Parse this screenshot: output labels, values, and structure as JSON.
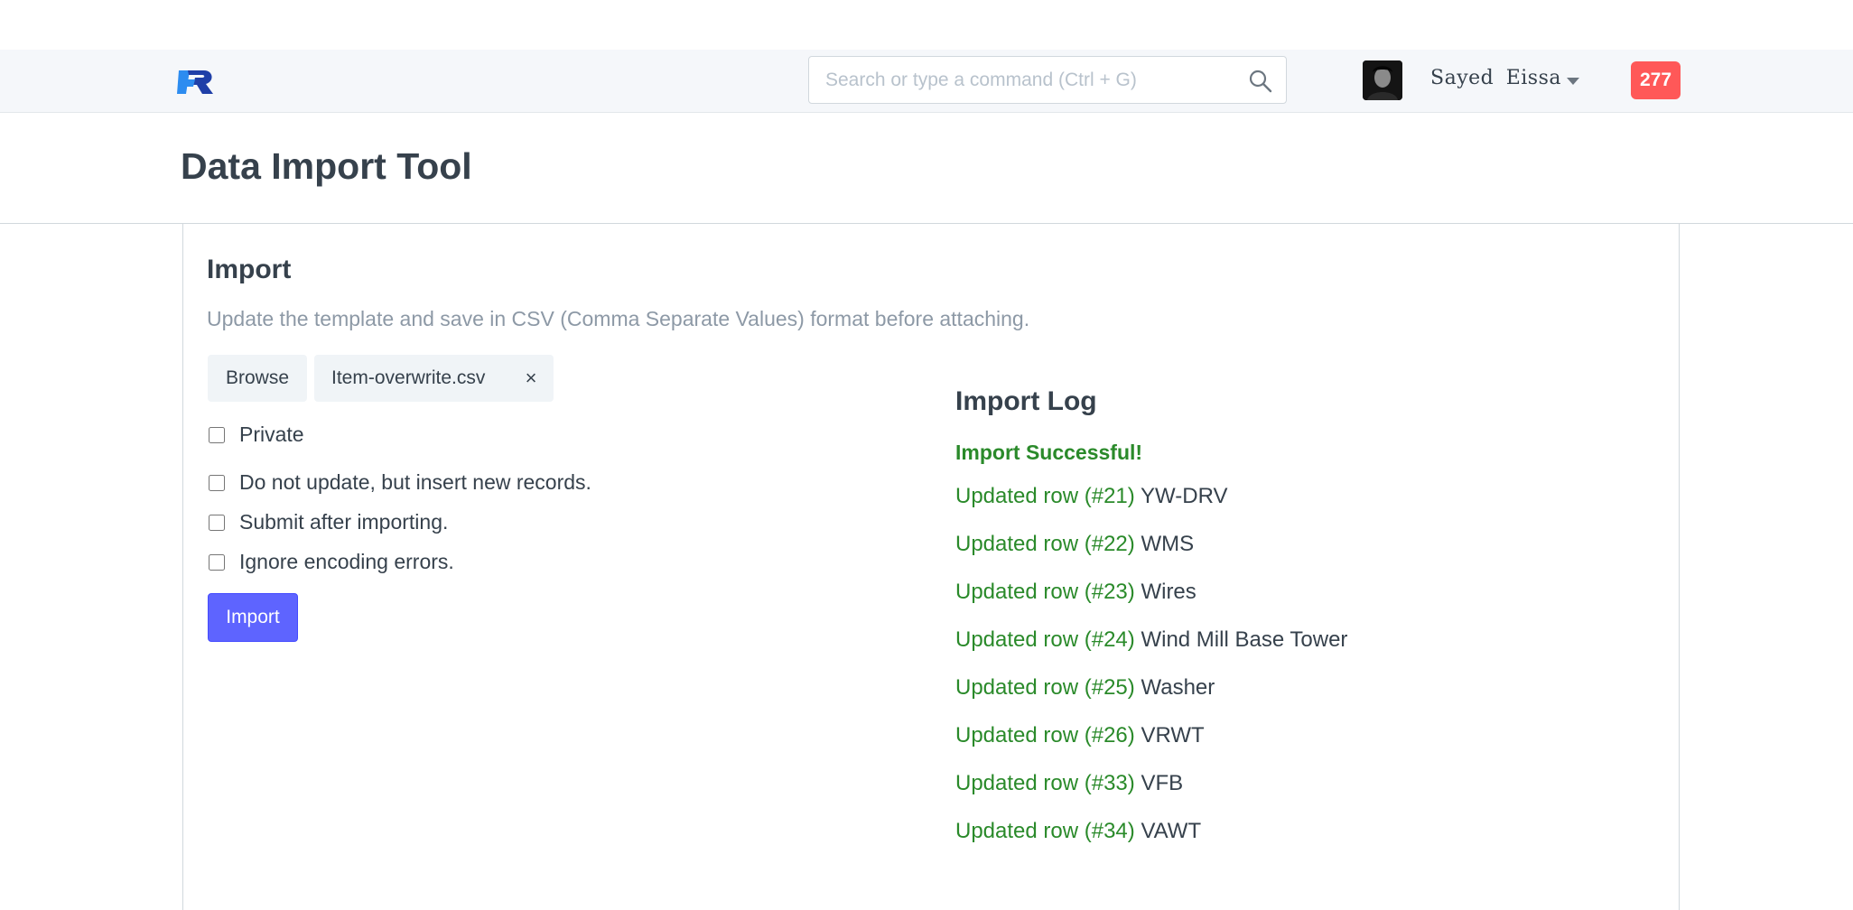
{
  "navbar": {
    "search_placeholder": "Search or type a command (Ctrl + G)",
    "user_name": "Sayed  Eissa",
    "notifications_count": "277"
  },
  "page": {
    "title": "Data Import Tool"
  },
  "import_section": {
    "title": "Import",
    "help_text": "Update the template and save in CSV (Comma Separate Values) format before attaching.",
    "browse_label": "Browse",
    "file_name": "Item-overwrite.csv",
    "remove_label": "×",
    "options": [
      {
        "label": "Private",
        "checked": false
      },
      {
        "label": "Do not update, but insert new records.",
        "checked": false
      },
      {
        "label": "Submit after importing.",
        "checked": false
      },
      {
        "label": "Ignore encoding errors.",
        "checked": false
      }
    ],
    "import_label": "Import"
  },
  "import_log": {
    "title": "Import Log",
    "success_message": "Import Successful!",
    "entries": [
      {
        "status": "Updated row (#21)",
        "name": "YW-DRV"
      },
      {
        "status": "Updated row (#22)",
        "name": "WMS"
      },
      {
        "status": "Updated row (#23)",
        "name": "Wires"
      },
      {
        "status": "Updated row (#24)",
        "name": "Wind Mill Base Tower"
      },
      {
        "status": "Updated row (#25)",
        "name": "Washer"
      },
      {
        "status": "Updated row (#26)",
        "name": "VRWT"
      },
      {
        "status": "Updated row (#33)",
        "name": "VFB"
      },
      {
        "status": "Updated row (#34)",
        "name": "VAWT"
      }
    ]
  },
  "colors": {
    "primary": "#5e64ff",
    "success": "#2a8a2a",
    "badge": "#ff5858",
    "text": "#36414c",
    "muted": "#8d99a6",
    "logo_dark": "#1f3fa8",
    "logo_light": "#2c8cf0"
  },
  "icons": {
    "logo": "app-logo-icon",
    "search": "search-icon",
    "dropdown": "caret-down-icon",
    "remove": "close-icon"
  }
}
